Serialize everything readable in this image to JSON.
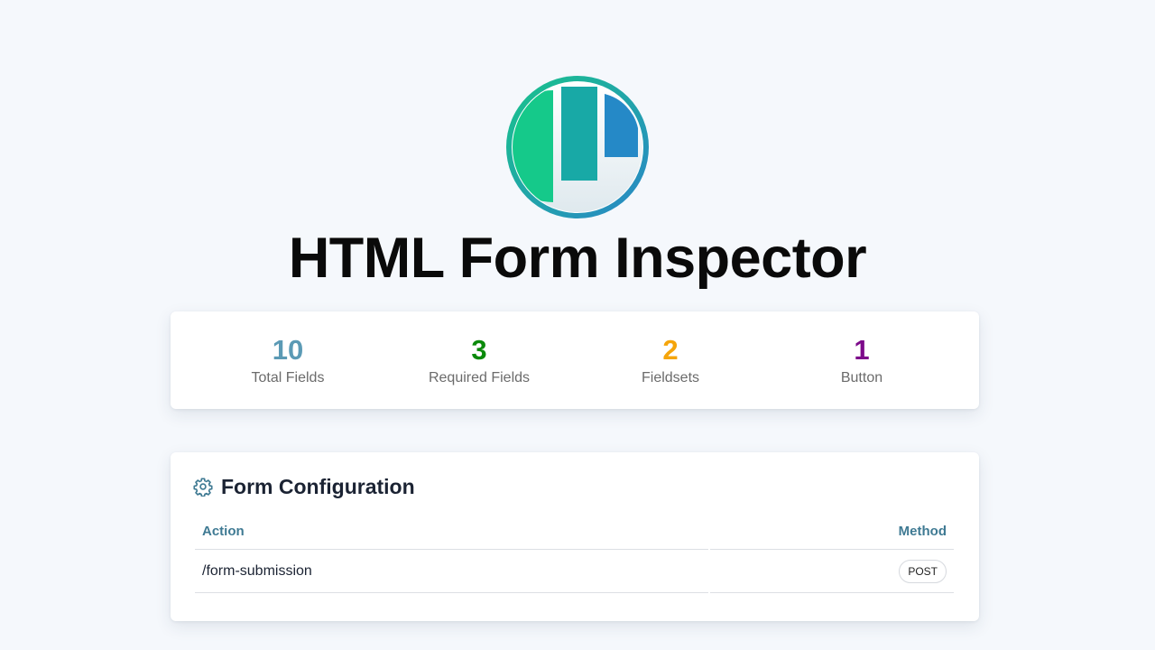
{
  "app": {
    "title": "HTML Form Inspector",
    "logo_icon": "form-inspector-logo-icon"
  },
  "stats": [
    {
      "value": "10",
      "label": "Total Fields",
      "color": "#5b9ab5"
    },
    {
      "value": "3",
      "label": "Required Fields",
      "color": "#0b8a0b"
    },
    {
      "value": "2",
      "label": "Fieldsets",
      "color": "#f5a50b"
    },
    {
      "value": "1",
      "label": "Button",
      "color": "#7d0b8a"
    }
  ],
  "form_config": {
    "title": "Form Configuration",
    "icon": "gear-icon",
    "columns": {
      "action": "Action",
      "method": "Method"
    },
    "rows": [
      {
        "action": "/form-submission",
        "method": "POST"
      }
    ]
  },
  "colors": {
    "background": "#f5f8fc",
    "accent": "#3f7a93"
  }
}
